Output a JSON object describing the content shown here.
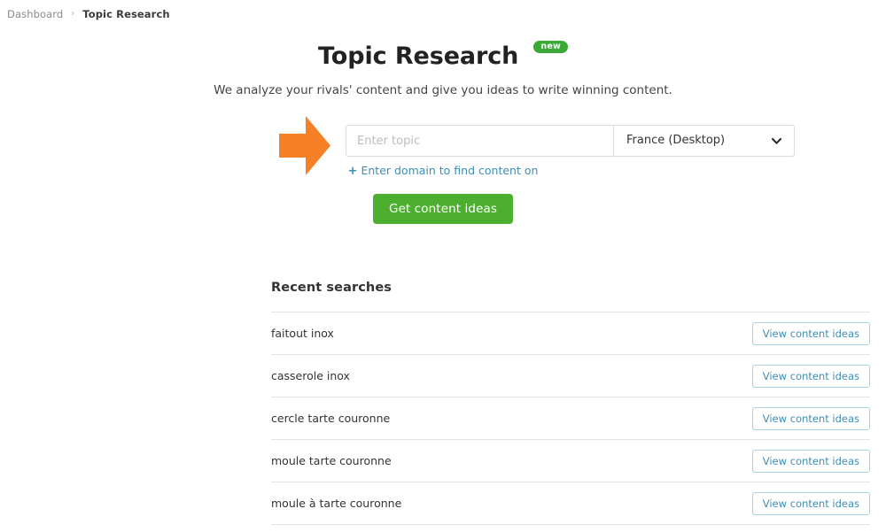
{
  "breadcrumb": {
    "parent_label": "Dashboard",
    "separator": "›",
    "current_label": "Topic Research"
  },
  "hero": {
    "title": "Topic Research",
    "badge": "new",
    "subtitle": "We analyze your rivals' content and give you ideas to write winning content.",
    "annotation_icon": "orange-right-arrow-icon",
    "annotation_color": "#f58025"
  },
  "search": {
    "topic_placeholder": "Enter topic",
    "topic_value": "",
    "database_selected": "France (Desktop)",
    "chevron_icon": "chevron-down-icon",
    "domain_link_plus": "+",
    "domain_link_label": "Enter domain to find content on",
    "submit_label": "Get content ideas",
    "submit_color": "#4caf2f",
    "link_color": "#3d8fb5"
  },
  "recent": {
    "heading": "Recent searches",
    "action_label": "View content ideas",
    "items": [
      {
        "term": "faitout inox"
      },
      {
        "term": "casserole inox"
      },
      {
        "term": "cercle tarte couronne"
      },
      {
        "term": "moule tarte couronne"
      },
      {
        "term": "moule à tarte couronne"
      }
    ]
  }
}
